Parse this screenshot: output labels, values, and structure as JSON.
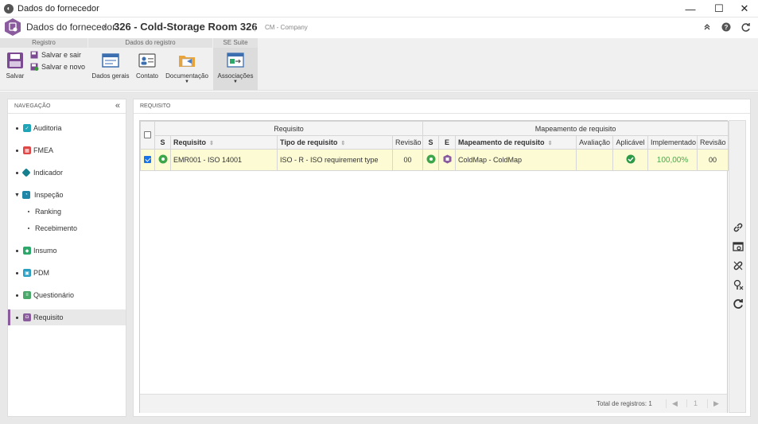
{
  "window": {
    "title": "Dados do fornecedor",
    "minimize": "—",
    "maximize": "☐",
    "close": "✕"
  },
  "header": {
    "breadcrumb": "Dados do fornecedor",
    "record_title": "326 - Cold-Storage Room 326",
    "company": "CM - Company"
  },
  "ribbon": {
    "groups": {
      "registro": "Registro",
      "dados_registro": "Dados do registro",
      "se_suite": "SE Suite"
    },
    "buttons": {
      "salvar": "Salvar",
      "salvar_sair": "Salvar e sair",
      "salvar_novo": "Salvar e novo",
      "dados_gerais": "Dados gerais",
      "contato": "Contato",
      "documentacao": "Documentação",
      "associacoes": "Associações"
    }
  },
  "navigation": {
    "title": "NAVEGAÇÃO",
    "items": [
      {
        "label": "Auditoria",
        "color": "#1fa5b8"
      },
      {
        "label": "FMEA",
        "color": "#e04848"
      },
      {
        "label": "Indicador",
        "color": "#17808e"
      },
      {
        "label": "Inspeção",
        "color": "#1f86a8"
      },
      {
        "label": "Ranking"
      },
      {
        "label": "Recebimento"
      },
      {
        "label": "Insumo",
        "color": "#2ba86a"
      },
      {
        "label": "PDM",
        "color": "#2a9fc4"
      },
      {
        "label": "Questionário",
        "color": "#4aa86a"
      },
      {
        "label": "Requisito",
        "color": "#8a5c9e"
      }
    ]
  },
  "content": {
    "title": "REQUISITO",
    "group_headers": {
      "requisito": "Requisito",
      "mapeamento": "Mapeamento de requisito"
    },
    "columns": {
      "s": "S",
      "requisito": "Requisito",
      "tipo": "Tipo de requisito",
      "revisao": "Revisão",
      "s2": "S",
      "e": "E",
      "mapeamento": "Mapeamento de requisito",
      "avaliacao": "Avaliação",
      "aplicavel": "Aplicável",
      "implementado": "Implementado",
      "revisao2": "Revisão"
    },
    "rows": [
      {
        "requisito": "EMR001 - ISO 14001",
        "tipo": "ISO - R - ISO requirement type",
        "revisao": "00",
        "mapeamento": "ColdMap - ColdMap",
        "avaliacao": "",
        "implementado": "100,00%",
        "revisao2": "00"
      }
    ],
    "footer": {
      "total": "Total de registros: 1",
      "page": "1",
      "prev": "◀",
      "next": "▶"
    }
  }
}
